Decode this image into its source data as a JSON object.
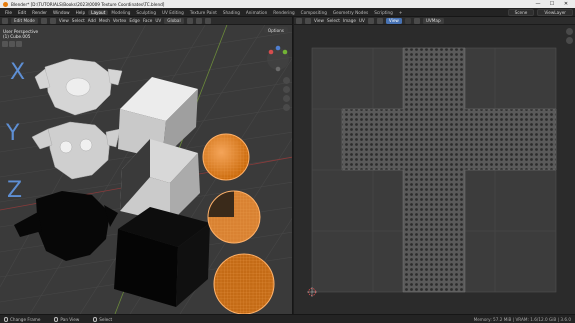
{
  "window": {
    "title": "Blender* [D:\\TUTORIALS\\Books\\2023\\0009 Texture Coordinates\\TC.blend]",
    "controls": [
      "—",
      "☐",
      "✕"
    ]
  },
  "menus": [
    "File",
    "Edit",
    "Render",
    "Window",
    "Help"
  ],
  "workspaces": [
    "Layout",
    "Modeling",
    "Sculpting",
    "UV Editing",
    "Texture Paint",
    "Shading",
    "Animation",
    "Rendering",
    "Compositing",
    "Geometry Nodes",
    "Scripting",
    "+"
  ],
  "active_workspace": "Layout",
  "scene": {
    "name": "Scene",
    "view_layer": "ViewLayer"
  },
  "viewport": {
    "header": {
      "mode": "Edit Mode",
      "menus": [
        "View",
        "Select",
        "Add",
        "Mesh",
        "Vertex",
        "Edge",
        "Face",
        "UV"
      ],
      "orientation": "Global",
      "options_label": "Options"
    },
    "info_line1": "User Perspective",
    "info_line2": "(1) Cube.005",
    "axis_labels": [
      "X",
      "Y",
      "Z"
    ],
    "mesh_highlight_color": "#e8811a"
  },
  "uv_editor": {
    "header": {
      "menus": [
        "View",
        "Select",
        "Image",
        "UV"
      ],
      "view_label": "View",
      "image_name": "",
      "uvmap": "UVMap"
    }
  },
  "status": {
    "items": [
      "Change Frame",
      "Pan View",
      "Select"
    ],
    "version": "Memory: 57.2 MiB | VRAM: 1.6/12.0 GiB | 3.6.0"
  }
}
